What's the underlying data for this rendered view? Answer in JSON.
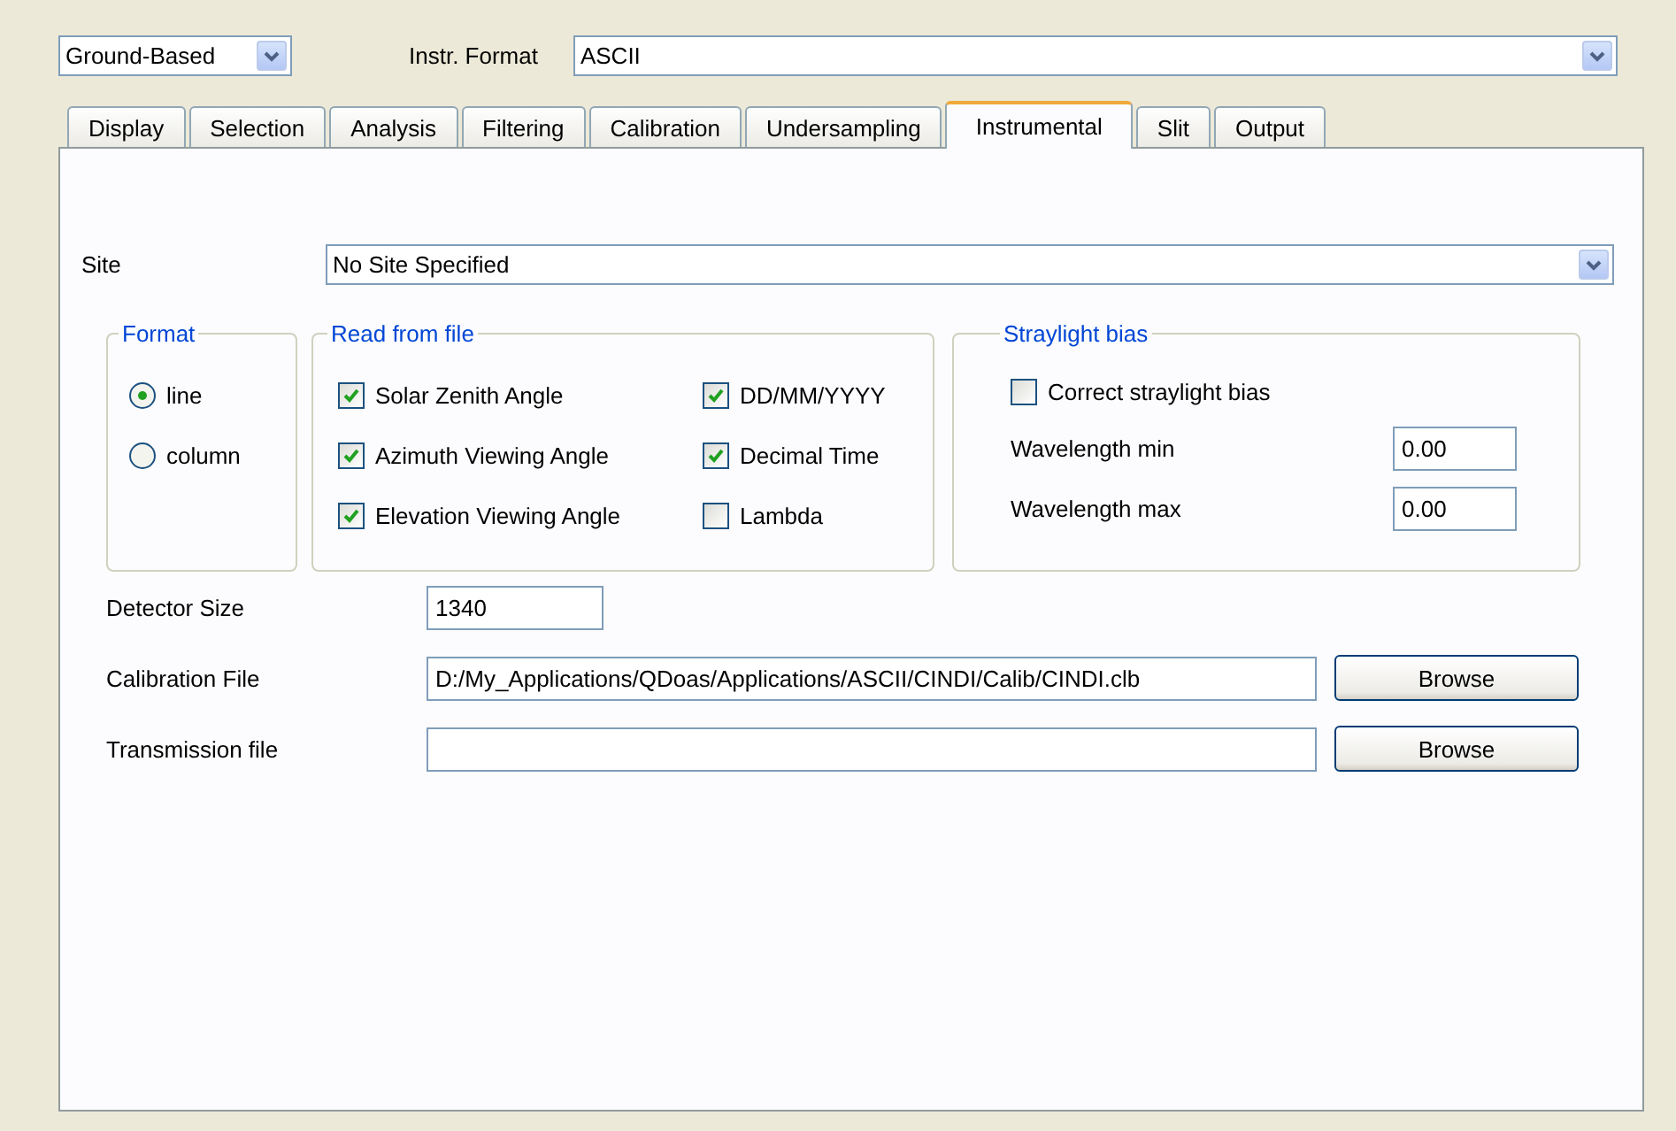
{
  "mode": {
    "value": "Ground-Based"
  },
  "instr_format": {
    "label": "Instr. Format",
    "value": "ASCII"
  },
  "tabs": [
    {
      "label": "Display",
      "selected": false
    },
    {
      "label": "Selection",
      "selected": false
    },
    {
      "label": "Analysis",
      "selected": false
    },
    {
      "label": "Filtering",
      "selected": false
    },
    {
      "label": "Calibration",
      "selected": false
    },
    {
      "label": "Undersampling",
      "selected": false
    },
    {
      "label": "Instrumental",
      "selected": true
    },
    {
      "label": "Slit",
      "selected": false
    },
    {
      "label": "Output",
      "selected": false
    }
  ],
  "site": {
    "label": "Site",
    "value": "No Site Specified"
  },
  "format": {
    "title": "Format",
    "options": [
      {
        "label": "line",
        "selected": true
      },
      {
        "label": "column",
        "selected": false
      }
    ]
  },
  "read_from_file": {
    "title": "Read from file",
    "items": [
      {
        "label": "Solar Zenith Angle",
        "checked": true
      },
      {
        "label": "DD/MM/YYYY",
        "checked": true
      },
      {
        "label": "Azimuth Viewing Angle",
        "checked": true
      },
      {
        "label": "Decimal Time",
        "checked": true
      },
      {
        "label": "Elevation Viewing Angle",
        "checked": true
      },
      {
        "label": "Lambda",
        "checked": false
      }
    ]
  },
  "straylight_bias": {
    "title": "Straylight bias",
    "correct": {
      "label": "Correct straylight bias",
      "checked": false
    },
    "fields": [
      {
        "label": "Wavelength min",
        "value": "0.00"
      },
      {
        "label": "Wavelength max",
        "value": "0.00"
      }
    ]
  },
  "fields": [
    {
      "label": "Detector Size",
      "value": "1340",
      "kind": "short"
    },
    {
      "label": "Calibration File",
      "value": "D:/My_Applications/QDoas/Applications/ASCII/CINDI/Calib/CINDI.clb",
      "kind": "file",
      "button": "Browse"
    },
    {
      "label": "Transmission file",
      "kind": "file",
      "button": "Browse"
    }
  ]
}
